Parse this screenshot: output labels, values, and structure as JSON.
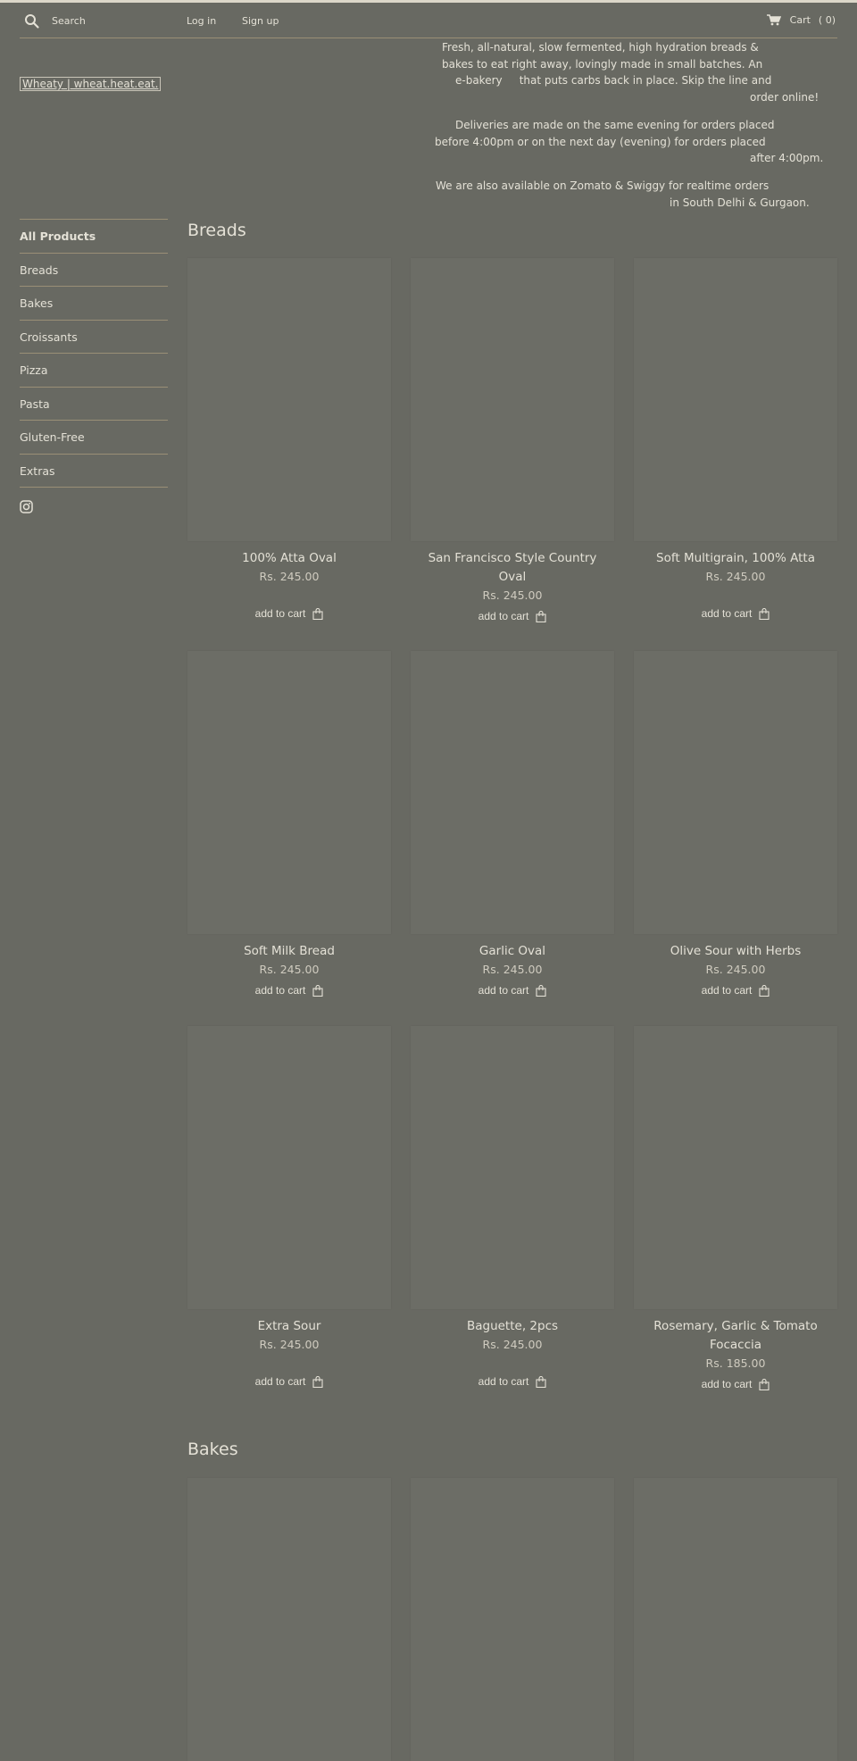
{
  "header": {
    "search_placeholder": "Search",
    "login_label": "Log in",
    "signup_label": "Sign up",
    "cart_label": "Cart",
    "cart_count": "( 0)"
  },
  "logo_text": "Wheaty | wheat.heat.eat.",
  "intro": {
    "p1": [
      "Fresh, all-natural, slow fermented, high hydration breads &",
      "bakes to eat right away, lovingly made in small batches. An",
      "e-bakery     that puts carbs back in place. Skip the line and",
      "order online!"
    ],
    "p2": [
      "Deliveries are made on the same evening for orders placed",
      "before 4:00pm or on the next day (evening) for orders placed",
      "after 4:00pm."
    ],
    "p3": [
      "We are also available on Zomato & Swiggy for realtime orders",
      "in South Delhi & Gurgaon."
    ]
  },
  "sidebar": {
    "items": [
      {
        "label": "All Products",
        "active": true
      },
      {
        "label": "Breads"
      },
      {
        "label": "Bakes"
      },
      {
        "label": "Croissants"
      },
      {
        "label": "Pizza"
      },
      {
        "label": "Pasta"
      },
      {
        "label": "Gluten-Free"
      },
      {
        "label": "Extras"
      }
    ]
  },
  "sections": [
    {
      "title": "Breads",
      "products": [
        {
          "name": "100% Atta Oval",
          "price": "Rs. 245.00",
          "cta": "add to cart"
        },
        {
          "name": "San Francisco Style Country Oval",
          "price": "Rs. 245.00",
          "cta": "add to cart"
        },
        {
          "name": "Soft Multigrain, 100% Atta",
          "price": "Rs. 245.00",
          "cta": "add to cart"
        },
        {
          "name": "Soft Milk Bread",
          "price": "Rs. 245.00",
          "cta": "add to cart"
        },
        {
          "name": "Garlic Oval",
          "price": "Rs. 245.00",
          "cta": "add to cart"
        },
        {
          "name": "Olive Sour with Herbs",
          "price": "Rs. 245.00",
          "cta": "add to cart"
        },
        {
          "name": "Extra Sour",
          "price": "Rs. 245.00",
          "cta": "add to cart"
        },
        {
          "name": "Baguette, 2pcs",
          "price": "Rs. 245.00",
          "cta": "add to cart"
        },
        {
          "name": "Rosemary, Garlic & Tomato Focaccia",
          "price": "Rs. 185.00",
          "cta": "add to cart"
        }
      ]
    },
    {
      "title": "Bakes",
      "products": [
        {},
        {},
        {}
      ]
    }
  ]
}
